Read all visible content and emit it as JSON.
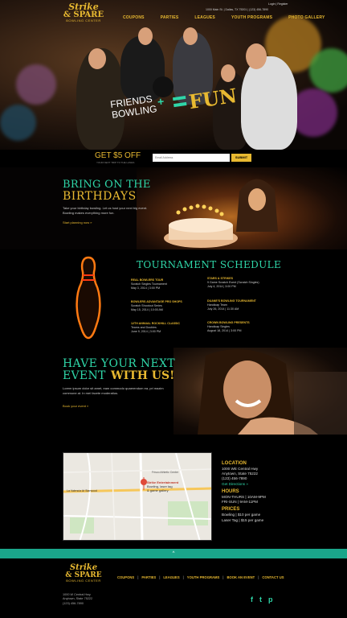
{
  "brand": {
    "line1": "Strike",
    "line2": "& SPARE",
    "line3": "BOWLING CENTER"
  },
  "header": {
    "login": "Login | Register",
    "address": "1000 Main St.  |  Dallas, TX 75201  |  (123) 456-7890",
    "nav": [
      "COUPONS",
      "PARTIES",
      "LEAGUES",
      "YOUTH PROGRAMS",
      "PHOTO GALLERY"
    ]
  },
  "hero": {
    "friends": "FRIENDS",
    "bowling": "BOWLING",
    "fun": "FUN"
  },
  "promo": {
    "get_off": "GET $5 OFF",
    "subtext": "YOUR NEXT TRIP TO THE LANES",
    "email_placeholder": "Email Address",
    "submit": "SUBMIT"
  },
  "birthday": {
    "heading1": "BRING ON THE",
    "heading2": "BIRTHDAYS",
    "text": "Take your birthday bowling. Let us host your next big event. Bowling makes everything more fun.",
    "link": "Start planning now »"
  },
  "tournament": {
    "title": "TOURNAMENT SCHEDULE",
    "events": [
      {
        "name": "REAL BOWLERS TOUR",
        "l1": "Scratch Singles Tournament",
        "l2": "May 3, 2014  |  3:00 PM"
      },
      {
        "name": "BOWLERS ADVANTAGE PRO SHOPS",
        "l1": "Scratch Shootout Series",
        "l2": "May 15, 2014  |  10:00 AM"
      },
      {
        "name": "12TH ANNUAL ROCKHILL CLASSIC",
        "l1": "Teams and Doubles",
        "l2": "June 9, 2014  |  3:00 PM"
      },
      {
        "name": "STARS & STRIKES",
        "l1": "9 Game Scratch Event (Scratch Singles)",
        "l2": "July 4, 2014  |  3:00 PM"
      },
      {
        "name": "DUANE'S BOWLING TOURNAMENT",
        "l1": "Handicap Team",
        "l2": "July 26, 2014  |  11:30 AM"
      },
      {
        "name": "CROWN BOWLING PRESENTS",
        "l1": "Handicap Singles",
        "l2": "August 18, 2014  |  3:00 PM"
      }
    ]
  },
  "event": {
    "heading1": "HAVE YOUR NEXT",
    "heading2a": "EVENT",
    "heading2b": "WITH US!",
    "text": "Lorem ipsum dolor sit amet, eam commodo quaerendum ea, pri mazim commune at. In mei facete moderatius.",
    "link": "Book your event »"
  },
  "map": {
    "marker_title": "Strike Entertainment",
    "marker_sub1": "Bowling, laser tag",
    "marker_sub2": "& game gallery",
    "label_center": "Frisco Athletic Center",
    "label_street": "La Valencia At Starwood"
  },
  "info": {
    "location_h": "LOCATION",
    "addr1": "1000 WE Central Hwy",
    "addr2": "Anytown, State 75222",
    "phone": "(123) 456-7890",
    "directions": "Get Directions »",
    "hours_h": "HOURS",
    "hours1": "MON-THURS  |  10AM-9PM",
    "hours2": "FRI-SUN  |  9AM-11PM",
    "prices_h": "PRICES",
    "price1": "Bowling  |  $10 per game",
    "price2": "Laser Tag  |  $15 per game"
  },
  "footer": {
    "nav": [
      "COUPONS",
      "PARTIES",
      "LEAGUES",
      "YOUTH PROGRAMS",
      "BOOK AN EVENT",
      "CONTACT US"
    ],
    "addr1": "1000 W Central Hwy",
    "addr2": "Anytown, State 75222",
    "phone": "(123) 456-7890",
    "social": [
      "f",
      "t",
      "p"
    ],
    "back_to_top": "^"
  },
  "colors": {
    "gold": "#e8b931",
    "teal": "#2fd6a8",
    "bar": "#1aa58a"
  }
}
